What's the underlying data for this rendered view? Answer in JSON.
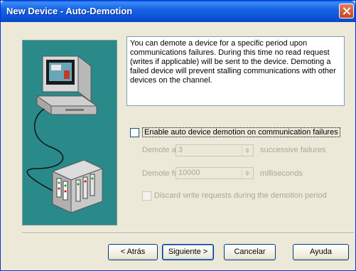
{
  "window": {
    "title": "New Device - Auto-Demotion"
  },
  "description": "You can demote a device for a specific period upon communications failures. During this time no read request (writes if applicable) will be sent to the device. Demoting a failed device will prevent stalling communications with other devices on the channel.",
  "enable": {
    "label": "Enable auto device demotion on communication failures",
    "checked": false
  },
  "demote_after": {
    "label": "Demote after",
    "value": "3",
    "suffix": "successive failures"
  },
  "demote_for": {
    "label": "Demote for",
    "value": "10000",
    "suffix": "milliseconds"
  },
  "discard": {
    "label": "Discard write requests during the demotion period",
    "checked": false
  },
  "buttons": {
    "back": "< Atrás",
    "next": "Siguiente >",
    "cancel": "Cancelar",
    "help": "Ayuda"
  },
  "colors": {
    "title_bar": "#0a5fdc",
    "art_bg": "#2a8a8a",
    "dialog_bg": "#ece9d8"
  },
  "icons": {
    "close": "close-icon",
    "computer": "computer-icon",
    "device": "device-rack-icon"
  }
}
